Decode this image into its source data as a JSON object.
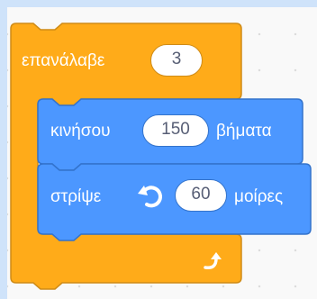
{
  "repeat_block": {
    "label": "επανάλαβε",
    "times": "3",
    "color": "#ffab19",
    "border_color": "#cf8b17"
  },
  "move_block": {
    "label": "κινήσου",
    "steps": "150",
    "suffix": "βήματα",
    "color": "#4c97ff",
    "border_color": "#3373cc"
  },
  "turn_block": {
    "label": "στρίψε",
    "icon": "rotate-left-icon",
    "degrees": "60",
    "suffix": "μοίρες",
    "color": "#4c97ff",
    "border_color": "#3373cc"
  },
  "loop_end_icon": "loop-arrow-icon"
}
